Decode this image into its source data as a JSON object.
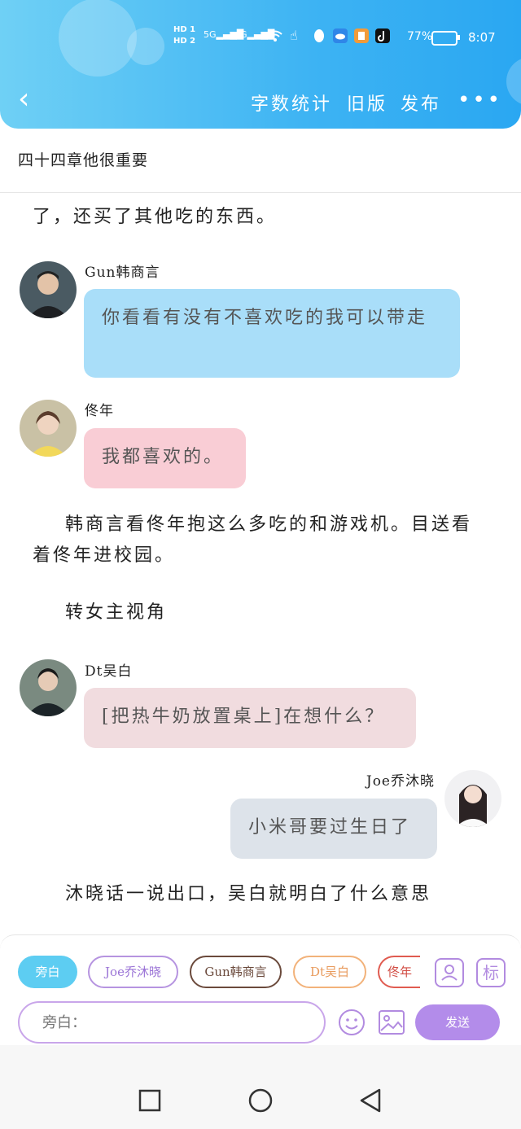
{
  "status_bar": {
    "hd1": "HD 1",
    "hd2": "HD 2",
    "net1": "5G",
    "net2": "4G",
    "battery": "77%",
    "time": "8:07"
  },
  "nav": {
    "items": [
      "字数统计",
      "旧版",
      "发布"
    ]
  },
  "chapter_title": "四十四章他很重要",
  "content": {
    "top_para": "了，还买了其他吃的东西。",
    "msg1": {
      "name": "Gun韩商言",
      "text": "你看看有没有不喜欢吃的我可以带走"
    },
    "msg2": {
      "name": "佟年",
      "text": "我都喜欢的。"
    },
    "para2": "韩商言看佟年抱这么多吃的和游戏机。目送看着佟年进校园。",
    "para3": "转女主视角",
    "msg3": {
      "name": "Dt吴白",
      "text": "[把热牛奶放置桌上]在想什么？"
    },
    "msg4": {
      "name": "Joe乔沐晓",
      "text": "小米哥要过生日了"
    },
    "para4": "沐晓话一说出口，吴白就明白了什么意思"
  },
  "chips": [
    "旁白",
    "Joe乔沐晓",
    "Gun韩商言",
    "Dt吴白",
    "佟年"
  ],
  "input": {
    "placeholder": "旁白：",
    "send": "发送",
    "tag_icon": "标"
  },
  "colors": {
    "header": "#3db3f3",
    "bubble_blue": "#a9def9",
    "bubble_pink": "#f9cdd5",
    "bubble_rose": "#f1dcdf",
    "bubble_gray": "#dde3ea",
    "send": "#b38cea"
  }
}
